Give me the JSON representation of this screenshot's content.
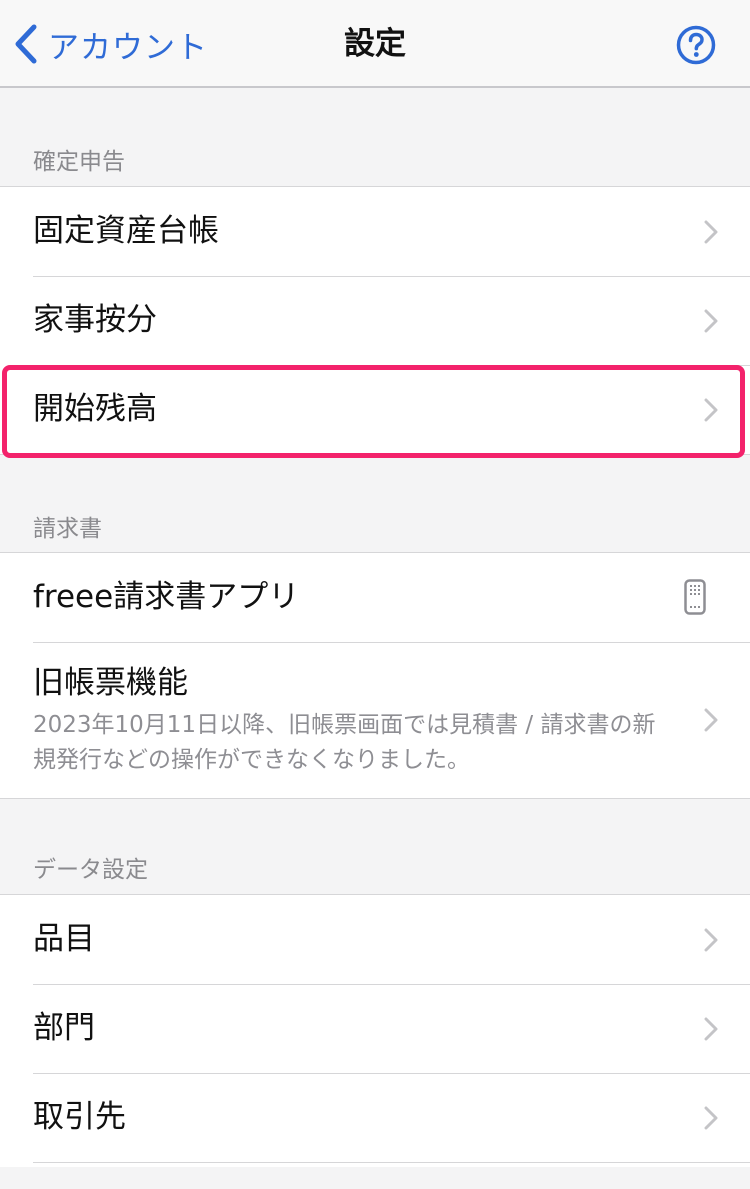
{
  "navbar": {
    "back_label": "アカウント",
    "title": "設定",
    "icons": {
      "back": "chevron-left-icon",
      "help": "question-circle-icon"
    },
    "accent_color": "#2f6bd6"
  },
  "sections": {
    "tax": {
      "header": "確定申告",
      "items": [
        {
          "label": "固定資産台帳"
        },
        {
          "label": "家事按分"
        },
        {
          "label": "開始残高",
          "highlighted": true
        }
      ]
    },
    "invoice": {
      "header": "請求書",
      "items": [
        {
          "label": "freee請求書アプリ",
          "icon": "mobile-device-icon"
        },
        {
          "label": "旧帳票機能",
          "description": "2023年10月11日以降、旧帳票画面では見積書 / 請求書の新規発行などの操作ができなくなりました。"
        }
      ]
    },
    "data": {
      "header": "データ設定",
      "items": [
        {
          "label": "品目"
        },
        {
          "label": "部門"
        },
        {
          "label": "取引先"
        }
      ]
    }
  },
  "highlight_color": "#f3226b"
}
